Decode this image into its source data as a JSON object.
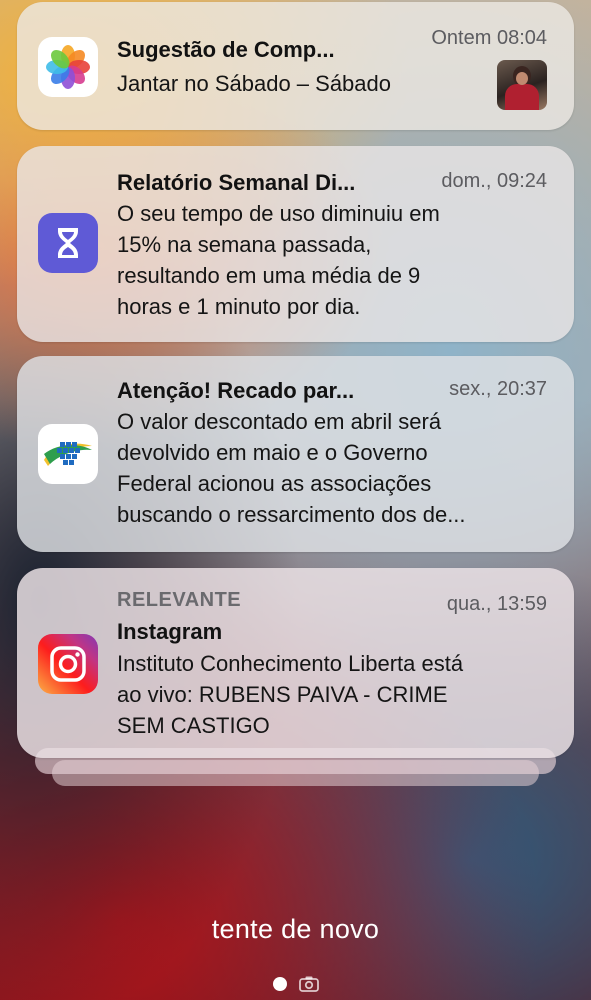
{
  "notifications": [
    {
      "app_icon": "photos-icon",
      "title": "Sugestão de Comp...",
      "time": "Ontem 08:04",
      "body": "Jantar no Sábado – Sábado",
      "thumbnail": "photo-thumbnail"
    },
    {
      "app_icon": "screen-time-hourglass-icon",
      "title": "Relatório Semanal Di...",
      "time": "dom., 09:24",
      "body_lines": [
        "O seu tempo de uso diminuiu em",
        "15% na semana passada,",
        "resultando em uma média de 9",
        "horas e 1 minuto por dia."
      ],
      "accent": "#5f5ad6"
    },
    {
      "app_icon": "inss-gov-icon",
      "title": "Atenção! Recado par...",
      "time": "sex., 20:37",
      "body_lines": [
        "O valor descontado em abril será",
        "devolvido em maio e o Governo",
        "Federal acionou as associações",
        "buscando o ressarcimento dos de..."
      ]
    },
    {
      "app_icon": "instagram-icon",
      "label": "RELEVANTE",
      "title": "Instagram",
      "time": "qua., 13:59",
      "body_lines": [
        "Instituto Conhecimento Liberta está",
        "ao vivo: RUBENS PAIVA - CRIME",
        "SEM CASTIGO"
      ]
    }
  ],
  "bottom": {
    "message": "tente de novo",
    "page_indicator_icon": "page-dot-icon",
    "camera_icon": "camera-icon"
  }
}
